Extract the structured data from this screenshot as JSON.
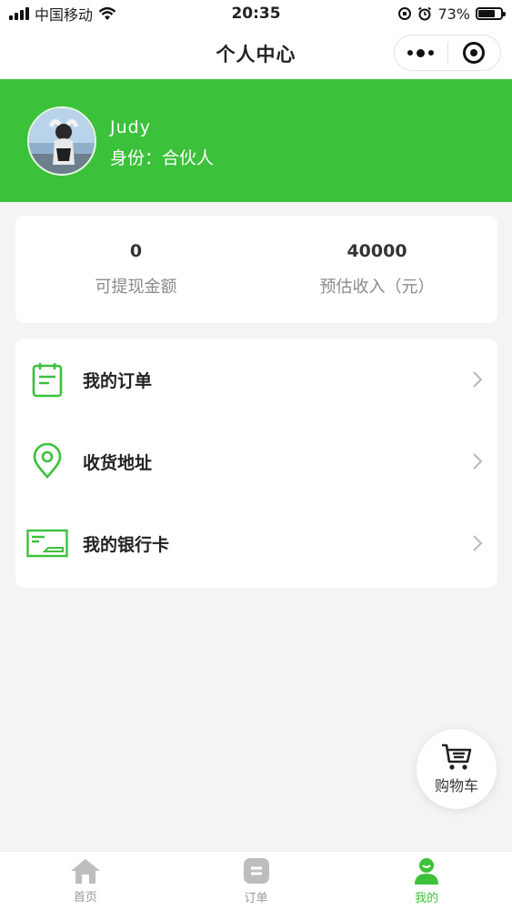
{
  "status_bar": {
    "carrier": "中国移动",
    "time": "20:35",
    "battery": "73%",
    "battery_level": 0.73
  },
  "nav": {
    "title": "个人中心",
    "more_icon": "more-dots-icon",
    "close_icon": "target-circle-icon"
  },
  "profile": {
    "name": "Judy",
    "role": "身份：合伙人",
    "theme_color": "#3cc13b"
  },
  "stats": [
    {
      "value": "0",
      "label": "可提现金额"
    },
    {
      "value": "40000",
      "label": "预估收入（元）"
    }
  ],
  "menu": [
    {
      "label": "我的订单",
      "icon": "order-calendar-icon"
    },
    {
      "label": "收货地址",
      "icon": "location-pin-icon"
    },
    {
      "label": "我的银行卡",
      "icon": "bank-card-icon"
    }
  ],
  "cart": {
    "label": "购物车",
    "icon": "shopping-cart-icon"
  },
  "tabs": [
    {
      "label": "首页",
      "icon": "home-icon",
      "active": false
    },
    {
      "label": "订单",
      "icon": "order-icon",
      "active": false
    },
    {
      "label": "我的",
      "icon": "user-icon",
      "active": true
    }
  ]
}
